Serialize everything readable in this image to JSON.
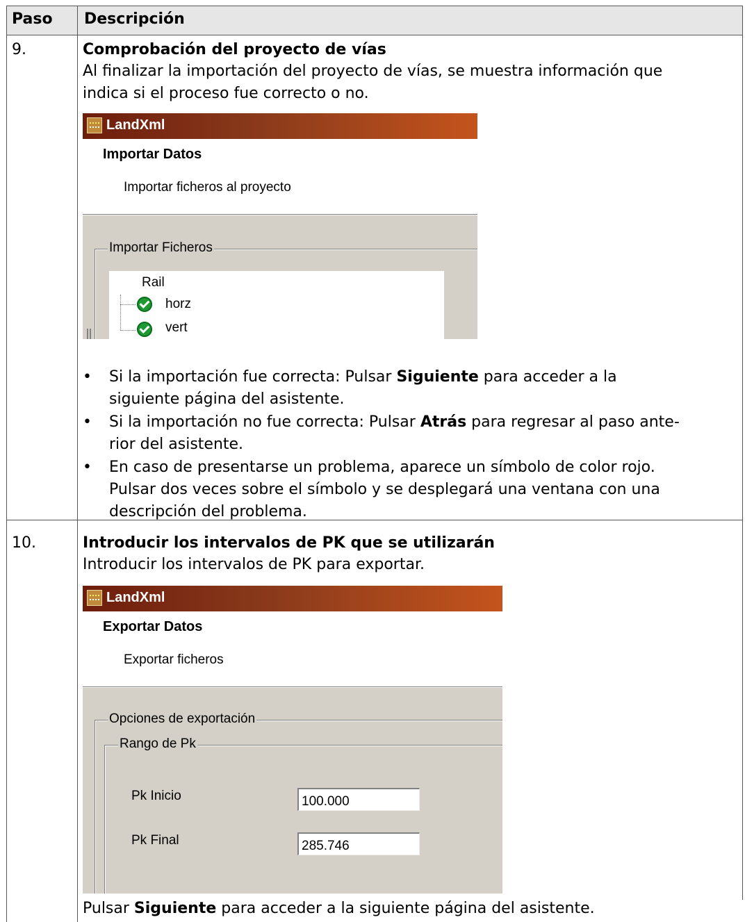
{
  "table": {
    "header_step": "Paso",
    "header_desc": "Descripción"
  },
  "step9": {
    "number": "9.",
    "title": "Comprobación del proyecto de vías",
    "intro_line1": "Al finalizar la importación del proyecto de vías, se muestra información que",
    "intro_line2": "indica si el proceso fue correcto o no.",
    "screenshot": {
      "app_title": "LandXml",
      "wizard_title": "Importar Datos",
      "wizard_subtitle": "Importar ficheros al proyecto",
      "group_label": "Importar Ficheros",
      "tree_root": "Rail",
      "tree_items": [
        "horz",
        "vert"
      ],
      "icon": "check-icon"
    },
    "bullets": [
      {
        "line1_pre": "Si la importación fue correcta: Pulsar ",
        "line1_bold": "Siguiente",
        "line1_post": " para acceder a la",
        "line2": "siguiente página del asistente."
      },
      {
        "line1_pre": "Si la importación no fue correcta: Pulsar ",
        "line1_bold": "Atrás",
        "line1_post": " para regresar al paso ante-",
        "line2": "rior del asistente."
      },
      {
        "line1": "En caso de presentarse un problema, aparece un símbolo de color rojo.",
        "line2": "Pulsar dos veces sobre el símbolo y se desplegará una ventana con una",
        "line3": "descripción del problema."
      }
    ]
  },
  "step10": {
    "number": "10.",
    "title": "Introducir los intervalos de PK que se utilizarán",
    "intro": "Introducir los intervalos de PK para exportar.",
    "screenshot": {
      "app_title": "LandXml",
      "wizard_title": "Exportar Datos",
      "wizard_subtitle": "Exportar ficheros",
      "group_label": "Opciones de exportación",
      "subgroup_label": "Rango de Pk",
      "start_label": "Pk Inicio",
      "start_value": "100.000",
      "end_label": "Pk Final",
      "end_value": "285.746"
    },
    "footer_pre": "Pulsar ",
    "footer_bold": "Siguiente",
    "footer_post": " para acceder a la siguiente página del asistente."
  }
}
